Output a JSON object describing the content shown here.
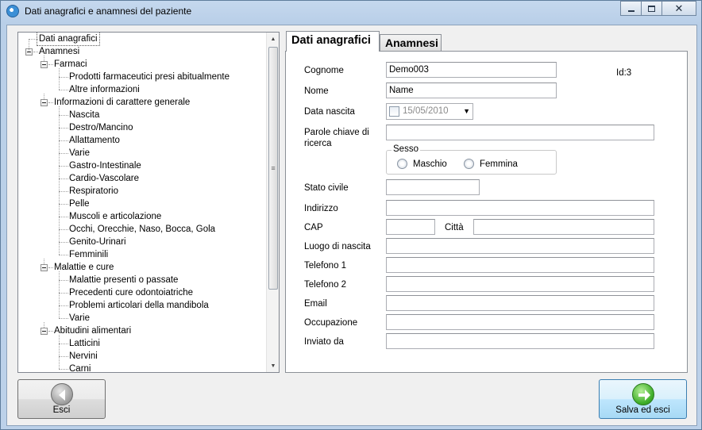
{
  "window": {
    "title": "Dati anagrafici e anamnesi del paziente"
  },
  "tree": {
    "items": [
      {
        "label": "Dati anagrafici",
        "level": 0,
        "expandable": false,
        "selected": true
      },
      {
        "label": "Anamnesi",
        "level": 0,
        "expandable": true
      },
      {
        "label": "Farmaci",
        "level": 1,
        "expandable": true
      },
      {
        "label": "Prodotti farmaceutici presi abitualmente",
        "level": 2,
        "expandable": false
      },
      {
        "label": "Altre informazioni",
        "level": 2,
        "expandable": false
      },
      {
        "label": "Informazioni di carattere generale",
        "level": 1,
        "expandable": true
      },
      {
        "label": "Nascita",
        "level": 2,
        "expandable": false
      },
      {
        "label": "Destro/Mancino",
        "level": 2,
        "expandable": false
      },
      {
        "label": "Allattamento",
        "level": 2,
        "expandable": false
      },
      {
        "label": "Varie",
        "level": 2,
        "expandable": false
      },
      {
        "label": "Gastro-Intestinale",
        "level": 2,
        "expandable": false
      },
      {
        "label": "Cardio-Vascolare",
        "level": 2,
        "expandable": false
      },
      {
        "label": "Respiratorio",
        "level": 2,
        "expandable": false
      },
      {
        "label": "Pelle",
        "level": 2,
        "expandable": false
      },
      {
        "label": "Muscoli e articolazione",
        "level": 2,
        "expandable": false
      },
      {
        "label": "Occhi, Orecchie, Naso, Bocca, Gola",
        "level": 2,
        "expandable": false
      },
      {
        "label": "Genito-Urinari",
        "level": 2,
        "expandable": false
      },
      {
        "label": "Femminili",
        "level": 2,
        "expandable": false
      },
      {
        "label": "Malattie e cure",
        "level": 1,
        "expandable": true
      },
      {
        "label": "Malattie presenti o passate",
        "level": 2,
        "expandable": false
      },
      {
        "label": "Precedenti cure odontoiatriche",
        "level": 2,
        "expandable": false
      },
      {
        "label": "Problemi articolari della mandibola",
        "level": 2,
        "expandable": false
      },
      {
        "label": "Varie",
        "level": 2,
        "expandable": false
      },
      {
        "label": "Abitudini alimentari",
        "level": 1,
        "expandable": true
      },
      {
        "label": "Latticini",
        "level": 2,
        "expandable": false
      },
      {
        "label": "Nervini",
        "level": 2,
        "expandable": false
      },
      {
        "label": "Carni",
        "level": 2,
        "expandable": false
      }
    ]
  },
  "tabs": {
    "dati": "Dati anagrafici",
    "anamnesi": "Anamnesi"
  },
  "form": {
    "cognome_label": "Cognome",
    "cognome_value": "Demo003",
    "id_text": "Id:3",
    "nome_label": "Nome",
    "nome_value": "Name",
    "data_label": "Data nascita",
    "data_value": "15/05/2010",
    "parole_label": "Parole chiave di ricerca",
    "parole_value": "",
    "sesso_title": "Sesso",
    "maschio": "Maschio",
    "femmina": "Femmina",
    "stato_label": "Stato civile",
    "stato_value": "",
    "indirizzo_label": "Indirizzo",
    "indirizzo_value": "",
    "cap_label": "CAP",
    "cap_value": "",
    "citta_label": "Città",
    "citta_value": "",
    "luogo_label": "Luogo di nascita",
    "luogo_value": "",
    "tel1_label": "Telefono 1",
    "tel1_value": "",
    "tel2_label": "Telefono 2",
    "tel2_value": "",
    "email_label": "Email",
    "email_value": "",
    "occupazione_label": "Occupazione",
    "occupazione_value": "",
    "invitato_label": "Inviato da",
    "invitato_value": ""
  },
  "buttons": {
    "esci": "Esci",
    "salva": "Salva ed esci"
  }
}
